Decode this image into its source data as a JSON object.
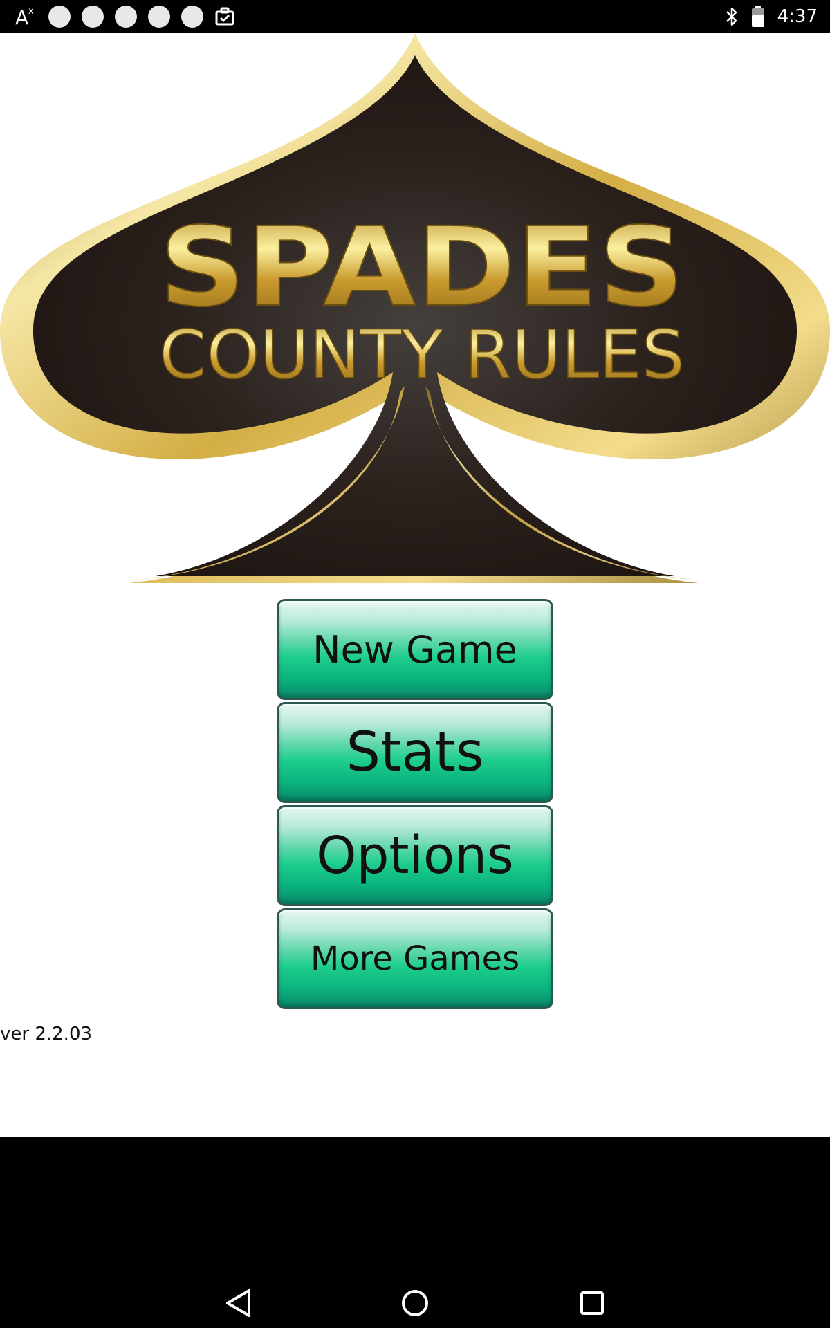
{
  "status_bar": {
    "time": "4:37",
    "left_icons": [
      "accessibility-text-icon",
      "notification-dot",
      "notification-dot",
      "notification-dot",
      "notification-dot",
      "notification-dot",
      "briefcase-check-icon"
    ],
    "right_icons": [
      "bluetooth-icon",
      "battery-icon"
    ]
  },
  "logo": {
    "line1": "SPADES",
    "line2": "COUNTY RULES",
    "colors": {
      "gold_light": "#f6e7a6",
      "gold": "#d4ae45",
      "gold_dark": "#8a6a1c",
      "spade_fill_center": "#45403d",
      "spade_fill_edge": "#1f1613"
    }
  },
  "menu": {
    "new_game": "New Game",
    "stats": "Stats",
    "options": "Options",
    "more_games": "More Games"
  },
  "version": "ver 2.2.03",
  "nav_bar": {
    "icons": [
      "back-icon",
      "home-icon",
      "recents-icon"
    ]
  },
  "colors": {
    "button_top": "#e6f7f1",
    "button_mid": "#1ece8c",
    "button_bottom": "#0a8a6a",
    "button_border": "#2b5a52",
    "background": "#ffffff",
    "bars": "#000000"
  }
}
